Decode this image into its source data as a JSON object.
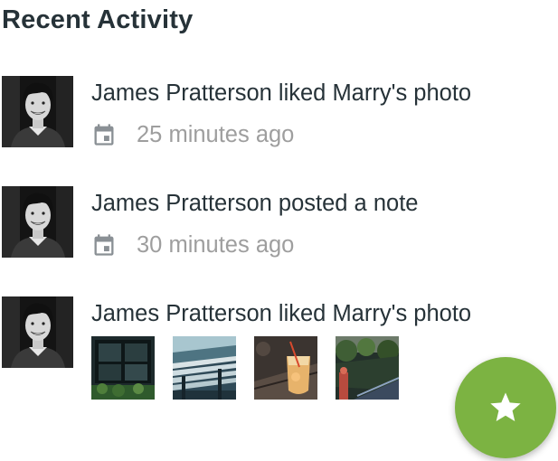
{
  "header": {
    "title": "Recent Activity"
  },
  "activities": [
    {
      "text": "James Pratterson liked Marry's photo",
      "time": "25 minutes ago"
    },
    {
      "text": "James Pratterson posted a note",
      "time": "30 minutes ago"
    },
    {
      "text": "James Pratterson liked Marry's photo"
    }
  ],
  "icons": {
    "time": "calendar-icon",
    "fab": "star-icon"
  },
  "colors": {
    "accent": "#7cb342",
    "meta_text": "#9e9e9e",
    "primary_text": "#263238"
  }
}
